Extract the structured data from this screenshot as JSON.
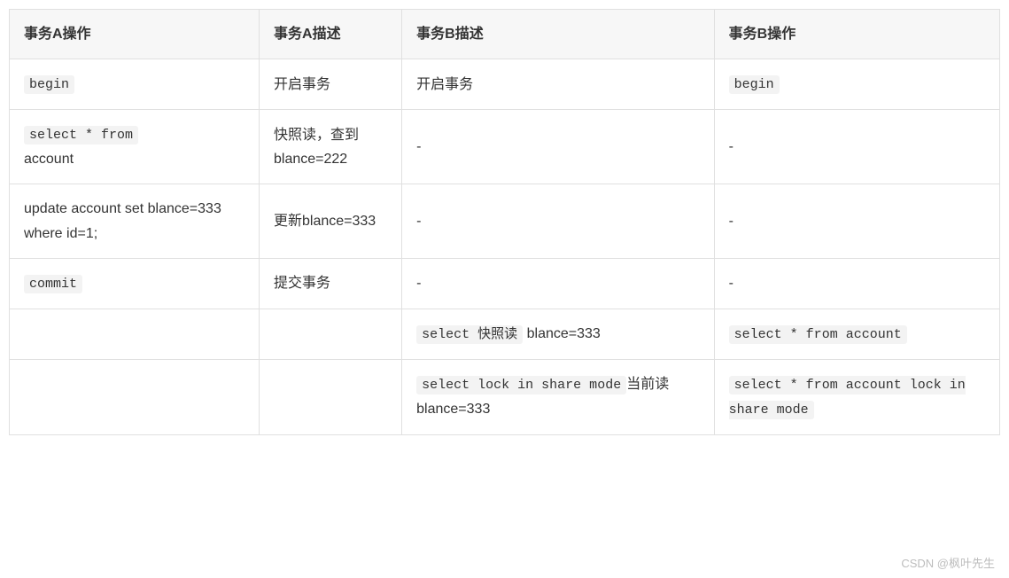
{
  "headers": {
    "col1": "事务A操作",
    "col2": "事务A描述",
    "col3": "事务B描述",
    "col4": "事务B操作"
  },
  "rows": [
    {
      "a_op_code": "begin",
      "a_desc": "开启事务",
      "b_desc": "开启事务",
      "b_op_code": "begin"
    },
    {
      "a_op_code_pre": "select * from",
      "a_op_code_post": "account",
      "a_desc": "快照读，查到blance=222",
      "b_desc": "-",
      "b_op": "-"
    },
    {
      "a_op": "update account set blance=333 where id=1;",
      "a_desc": "更新blance=333",
      "b_desc": "-",
      "b_op": "-"
    },
    {
      "a_op_code": "commit",
      "a_desc": "提交事务",
      "b_desc": "-",
      "b_op": "-"
    },
    {
      "a_op": "",
      "a_desc": "",
      "b_desc_code": "select 快照读",
      "b_desc_text": " blance=333",
      "b_op_code": "select * from account"
    },
    {
      "a_op": "",
      "a_desc": "",
      "b_desc_code": "select lock in share mode",
      "b_desc_text2": "当前读",
      "b_desc_text3": " blance=333",
      "b_op_code": "select * from account lock in share mode"
    }
  ],
  "watermark": "CSDN @枫叶先生"
}
